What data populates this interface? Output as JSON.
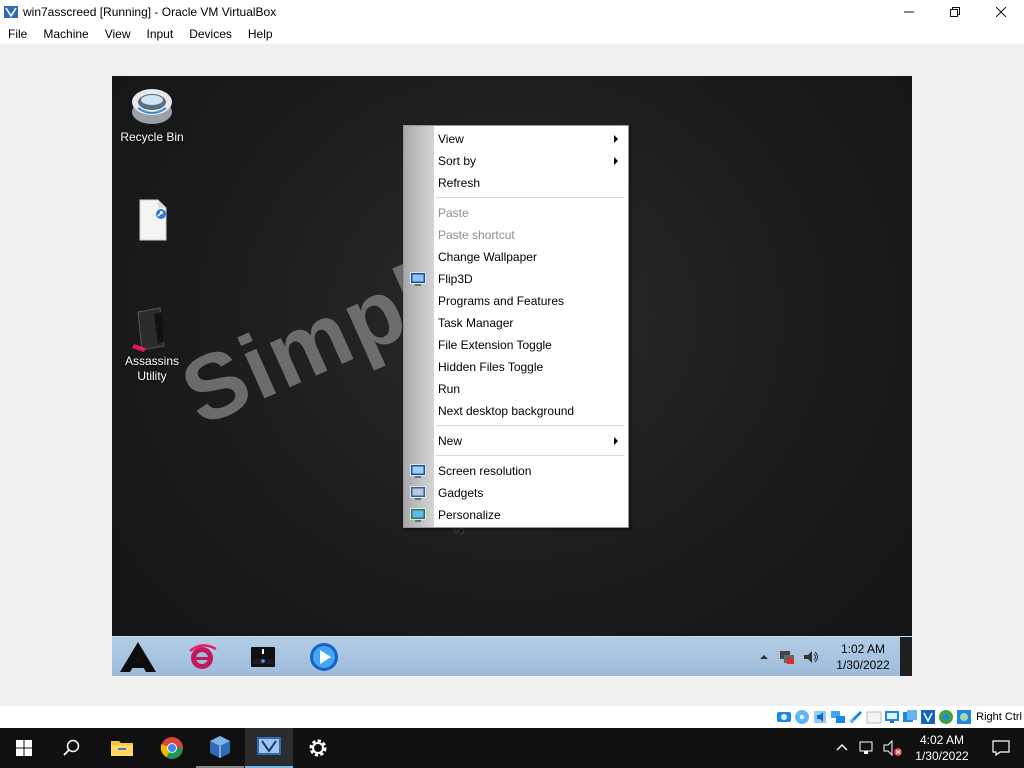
{
  "window": {
    "title": "win7asscreed [Running] - Oracle VM VirtualBox"
  },
  "menubar": {
    "items": [
      "File",
      "Machine",
      "View",
      "Input",
      "Devices",
      "Help"
    ]
  },
  "desktop": {
    "watermark": "Simpl",
    "watermark_small": "s.",
    "icons": [
      {
        "label": "Recycle Bin",
        "icon": "recycle-bin-icon"
      },
      {
        "label": "",
        "icon": "shortcut-file-icon"
      },
      {
        "label": "Assassins Utility",
        "icon": "assassins-utility-icon"
      }
    ]
  },
  "context_menu": {
    "items": [
      {
        "label": "View",
        "submenu": true,
        "disabled": false
      },
      {
        "label": "Sort by",
        "submenu": true,
        "disabled": false
      },
      {
        "label": "Refresh",
        "submenu": false,
        "disabled": false
      },
      {
        "label": "Paste",
        "submenu": false,
        "disabled": true
      },
      {
        "label": "Paste shortcut",
        "submenu": false,
        "disabled": true
      },
      {
        "label": "Change Wallpaper",
        "submenu": false,
        "disabled": false
      },
      {
        "label": "Flip3D",
        "submenu": false,
        "disabled": false,
        "icon": "flip3d-icon"
      },
      {
        "label": "Programs and Features",
        "submenu": false,
        "disabled": false
      },
      {
        "label": "Task Manager",
        "submenu": false,
        "disabled": false
      },
      {
        "label": "File Extension Toggle",
        "submenu": false,
        "disabled": false
      },
      {
        "label": "Hidden Files Toggle",
        "submenu": false,
        "disabled": false
      },
      {
        "label": "Run",
        "submenu": false,
        "disabled": false
      },
      {
        "label": "Next desktop background",
        "submenu": false,
        "disabled": false
      },
      {
        "label": "New",
        "submenu": true,
        "disabled": false
      },
      {
        "label": "Screen resolution",
        "submenu": false,
        "disabled": false,
        "icon": "screen-resolution-icon"
      },
      {
        "label": "Gadgets",
        "submenu": false,
        "disabled": false,
        "icon": "gadgets-icon"
      },
      {
        "label": "Personalize",
        "submenu": false,
        "disabled": false,
        "icon": "personalize-icon"
      }
    ]
  },
  "guest_taskbar": {
    "pinned": [
      "assassins-start-icon",
      "internet-explorer-icon",
      "drive-icon",
      "media-player-icon"
    ],
    "clock_time": "1:02 AM",
    "clock_date": "1/30/2022"
  },
  "vbox_status": {
    "host_key": "Right Ctrl"
  },
  "host_taskbar": {
    "apps": [
      "search-icon",
      "file-explorer-icon",
      "chrome-icon",
      "virtualbox-icon",
      "virtualbox-vm-icon",
      "settings-icon"
    ],
    "clock_time": "4:02 AM",
    "clock_date": "1/30/2022"
  }
}
